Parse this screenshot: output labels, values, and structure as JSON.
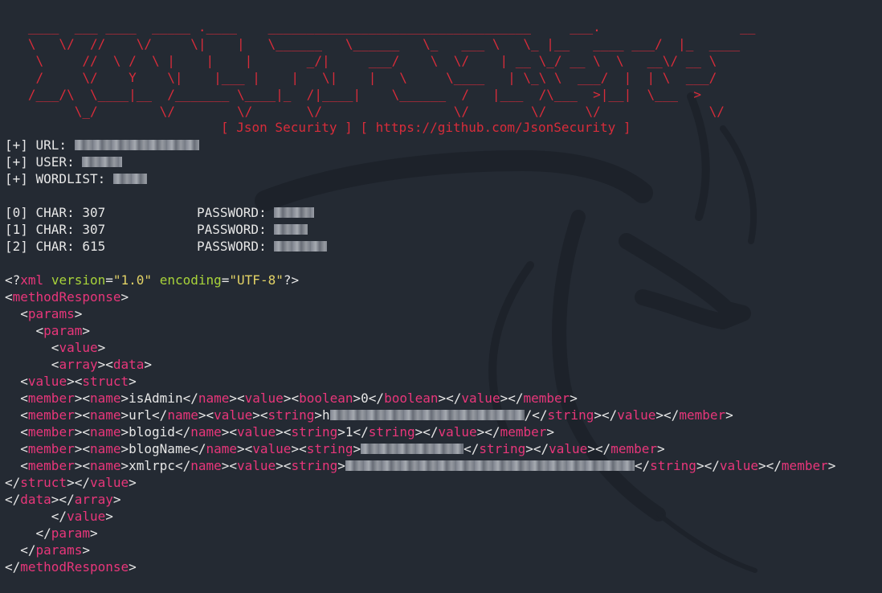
{
  "banner": {
    "ascii_lines": [
      "   ____  ___ ____  _____ .____    __________________________________     ___.                  __          ",
      "   \\   \\/  //    \\/     \\|    |   \\______   \\______   \\_   ___ \\   \\_ |__   ____ ___/  |_  ____  ",
      "    \\     //  \\ /  \\ |    |    |       _/|     ___/    \\  \\/    | __ \\_/ __ \\  \\   __\\/ __ \\ ",
      "    /     \\/    Y    \\|    |___ |    |   \\|    |   \\     \\____   | \\_\\ \\  ___/  |  | \\  ___/ ",
      "   /___/\\  \\____|__  /_______ \\____|_  /|____|    \\______  /   |___  /\\___  >|__|  \\___  >",
      "         \\_/        \\/        \\/       \\/                 \\/        \\/     \\/              \\/ "
    ],
    "subtitle": "[ Json Security ] [ https://github.com/JsonSecurity ]"
  },
  "info": [
    {
      "prefix": "[+] URL: ",
      "redacted_width": 155
    },
    {
      "prefix": "[+] USER: ",
      "redacted_width": 50
    },
    {
      "prefix": "[+] WORDLIST: ",
      "redacted_width": 42
    }
  ],
  "results": [
    {
      "label": "[0] CHAR: 307",
      "pw_label": "PASSWORD: ",
      "redacted_width": 50
    },
    {
      "label": "[1] CHAR: 307",
      "pw_label": "PASSWORD: ",
      "redacted_width": 42
    },
    {
      "label": "[2] CHAR: 615",
      "pw_label": "PASSWORD: ",
      "redacted_width": 66
    }
  ],
  "xml": {
    "decl_open": "<?",
    "decl_name": "xml",
    "decl_attr1": "version",
    "decl_val1": "\"1.0\"",
    "decl_attr2": "encoding",
    "decl_val2": "\"UTF-8\"",
    "decl_close": "?>",
    "methodResponse": "methodResponse",
    "params": "params",
    "param": "param",
    "value": "value",
    "array": "array",
    "data": "data",
    "struct": "struct",
    "member": "member",
    "name": "name",
    "boolean": "boolean",
    "string": "string",
    "members": [
      {
        "name": "isAdmin",
        "type": "boolean",
        "text": "0"
      },
      {
        "name": "url",
        "type": "string",
        "text": "h",
        "redacted_width": 242,
        "suffix": "/"
      },
      {
        "name": "blogid",
        "type": "string",
        "text": "1"
      },
      {
        "name": "blogName",
        "type": "string",
        "text": "",
        "redacted_width": 128
      },
      {
        "name": "xmlrpc",
        "type": "string",
        "text": "",
        "redacted_width": 360
      }
    ]
  },
  "colors": {
    "background": "#242a33",
    "banner": "#d82c3a",
    "tag": "#e8367a",
    "attribute": "#a8d33a",
    "attribute_value": "#e3d266",
    "text": "#e6e6e6"
  }
}
